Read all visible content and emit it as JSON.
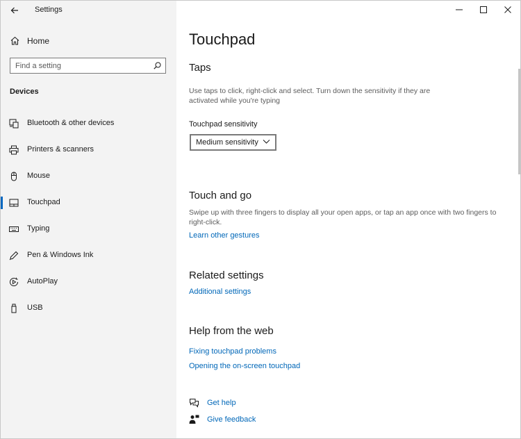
{
  "window": {
    "title": "Settings"
  },
  "sidebar": {
    "home_label": "Home",
    "search_placeholder": "Find a setting",
    "section": "Devices",
    "items": [
      {
        "label": "Bluetooth & other devices",
        "icon": "bluetooth-devices-icon",
        "selected": false
      },
      {
        "label": "Printers & scanners",
        "icon": "printer-icon",
        "selected": false
      },
      {
        "label": "Mouse",
        "icon": "mouse-icon",
        "selected": false
      },
      {
        "label": "Touchpad",
        "icon": "touchpad-icon",
        "selected": true
      },
      {
        "label": "Typing",
        "icon": "keyboard-icon",
        "selected": false
      },
      {
        "label": "Pen & Windows Ink",
        "icon": "pen-icon",
        "selected": false
      },
      {
        "label": "AutoPlay",
        "icon": "autoplay-icon",
        "selected": false
      },
      {
        "label": "USB",
        "icon": "usb-icon",
        "selected": false
      }
    ]
  },
  "main": {
    "title": "Touchpad",
    "taps": {
      "heading": "Taps",
      "description": "Use taps to click, right-click and select. Turn down the sensitivity if they are activated while you're typing",
      "sensitivity_label": "Touchpad sensitivity",
      "sensitivity_value": "Medium sensitivity"
    },
    "touch_and_go": {
      "heading": "Touch and go",
      "description": "Swipe up with three fingers to display all your open apps, or tap an app once with two fingers to right-click.",
      "link": "Learn other gestures"
    },
    "related": {
      "heading": "Related settings",
      "link": "Additional settings"
    },
    "help": {
      "heading": "Help from the web",
      "links": [
        "Fixing touchpad problems",
        "Opening the on-screen touchpad"
      ]
    },
    "get_help": "Get help",
    "give_feedback": "Give feedback"
  },
  "colors": {
    "accent": "#0067c0",
    "link": "#0067b8",
    "sidebar_bg": "#f3f3f3"
  }
}
